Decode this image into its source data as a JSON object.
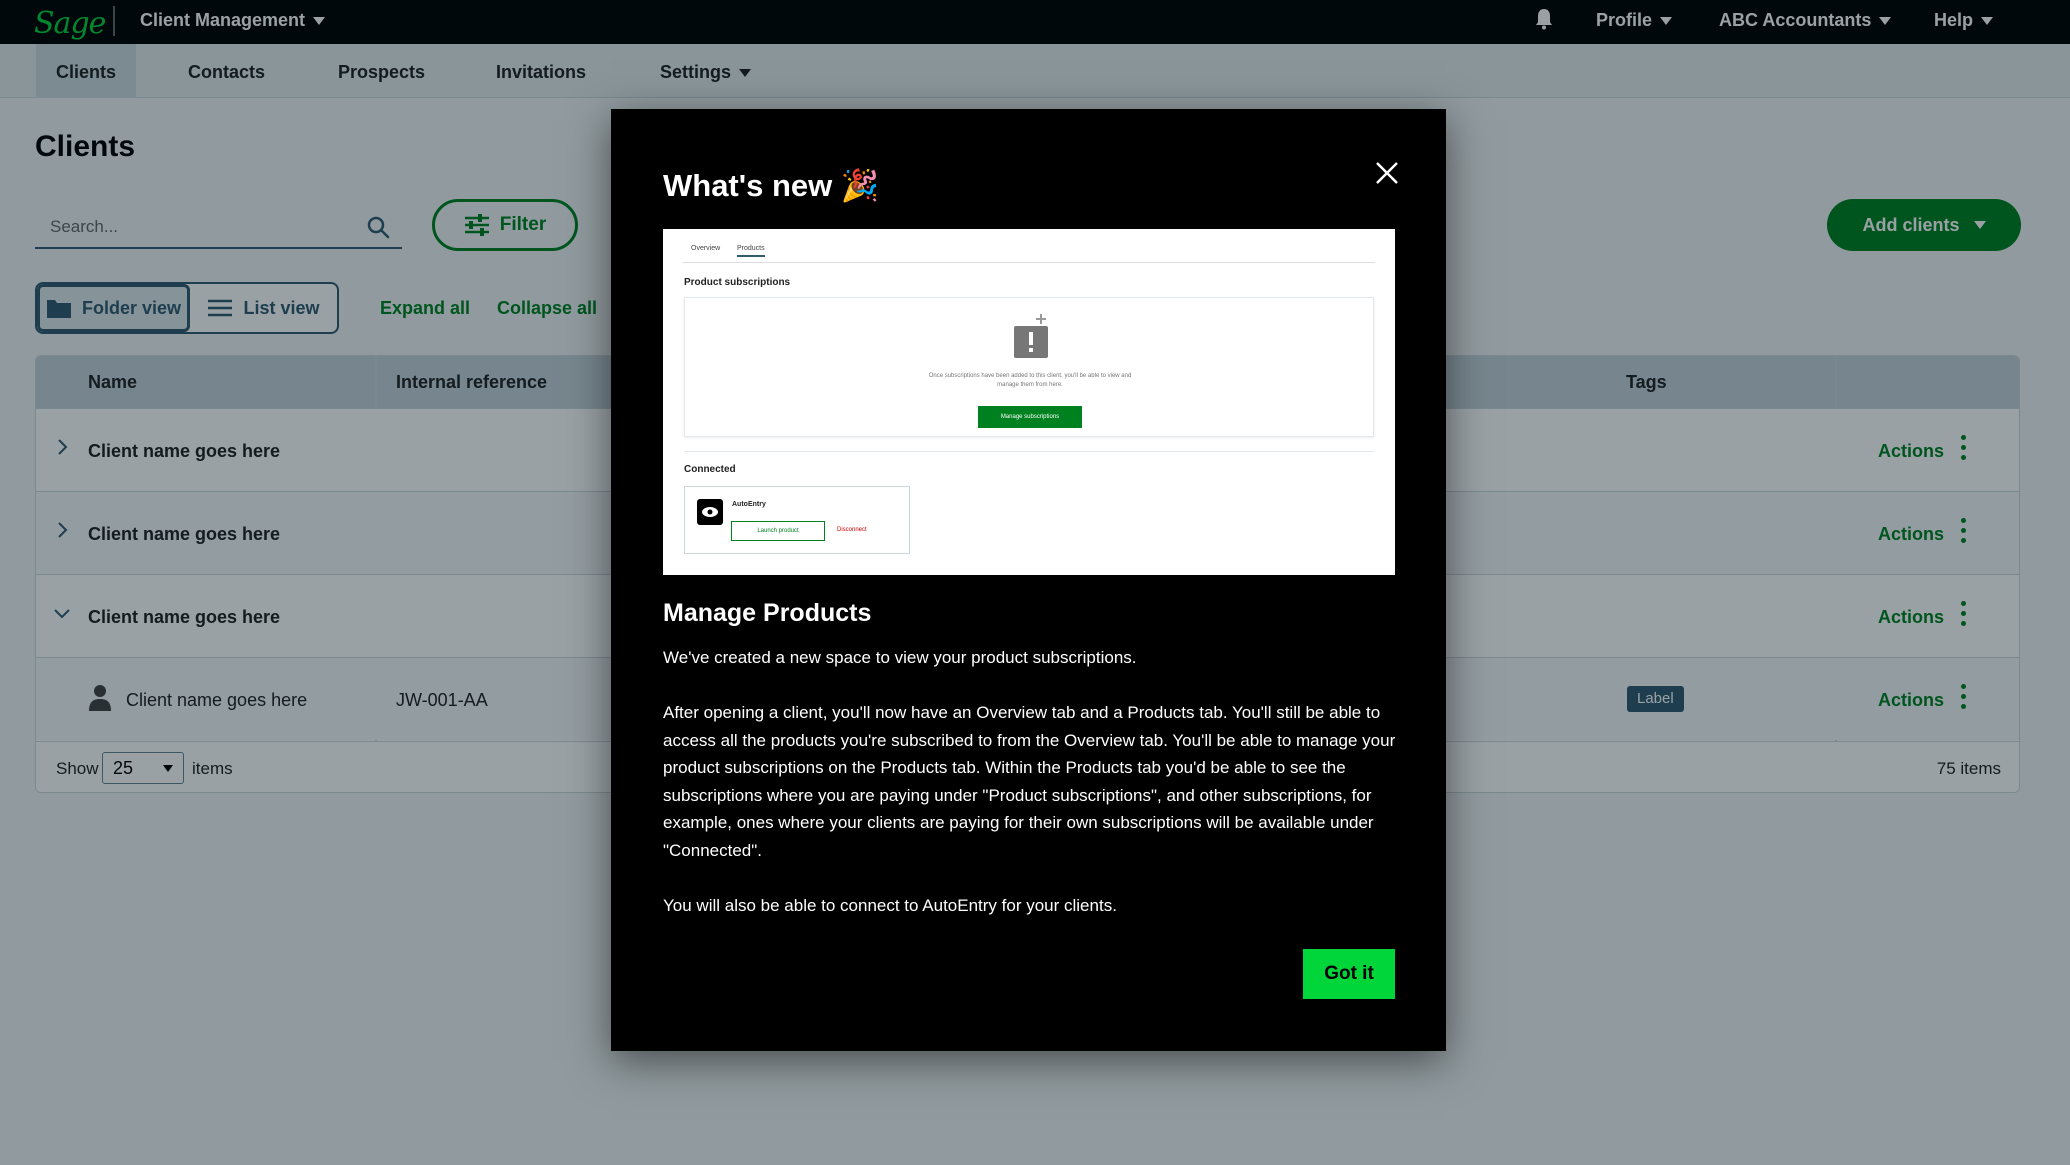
{
  "topbar": {
    "logo": "Sage",
    "app_title": "Client Management",
    "profile": "Profile",
    "account": "ABC Accountants",
    "help": "Help",
    "bell_icon": "bell-icon"
  },
  "nav": {
    "tabs": [
      {
        "label": "Clients",
        "active": true
      },
      {
        "label": "Contacts"
      },
      {
        "label": "Prospects"
      },
      {
        "label": "Invitations"
      },
      {
        "label": "Settings"
      }
    ]
  },
  "page": {
    "title": "Clients",
    "search_placeholder": "Search...",
    "filter_label": "Filter",
    "folder_view": "Folder view",
    "list_view": "List view",
    "expand_all": "Expand all",
    "collapse_all": "Collapse all",
    "add_clients": "Add clients"
  },
  "table": {
    "headers": {
      "name": "Name",
      "internal_reference": "Internal reference",
      "tags": "Tags"
    },
    "rows": [
      {
        "name": "Client name goes here",
        "expanded": false,
        "actions": "Actions"
      },
      {
        "name": "Client name goes here",
        "expanded": false,
        "actions": "Actions"
      },
      {
        "name": "Client name goes here",
        "expanded": true,
        "actions": "Actions"
      },
      {
        "name": "Client name goes here",
        "ref": "JW-001-AA",
        "tag": "Label",
        "actions": "Actions",
        "child": true
      }
    ],
    "footer": {
      "show": "Show",
      "page_size": "25",
      "items": "items",
      "total": "75 items"
    }
  },
  "modal": {
    "title": "What's new",
    "title_emoji": "🎉",
    "preview": {
      "tabs": [
        "Overview",
        "Products"
      ],
      "section_title": "Product subscriptions",
      "empty_text": "Once subscriptions have been added to this client, you'll be able to view and manage them from here.",
      "manage_button": "Manage subscriptions",
      "connected_title": "Connected",
      "product_name": "AutoEntry",
      "launch_button": "Launch product",
      "disconnect": "Disconnect"
    },
    "heading": "Manage Products",
    "paragraphs": [
      "We've created a new space to view your product subscriptions.",
      "After opening a client, you'll now have an Overview tab and a Products tab. You'll still be able to access all the products you're subscribed to from the Overview tab. You'll be able to manage your product subscriptions on the Products tab. Within the Products tab you'd be able to see the subscriptions where you are paying under \"Product subscriptions\", and other subscriptions, for example, ones where your clients are paying for their own subscriptions will be available under \"Connected\".",
      "You will also be able to connect to AutoEntry for your clients."
    ],
    "got_it": "Got it"
  },
  "colors": {
    "brand_green": "#00d639",
    "action_green": "#00811f",
    "navy": "#335b70",
    "topbar": "#000000"
  }
}
